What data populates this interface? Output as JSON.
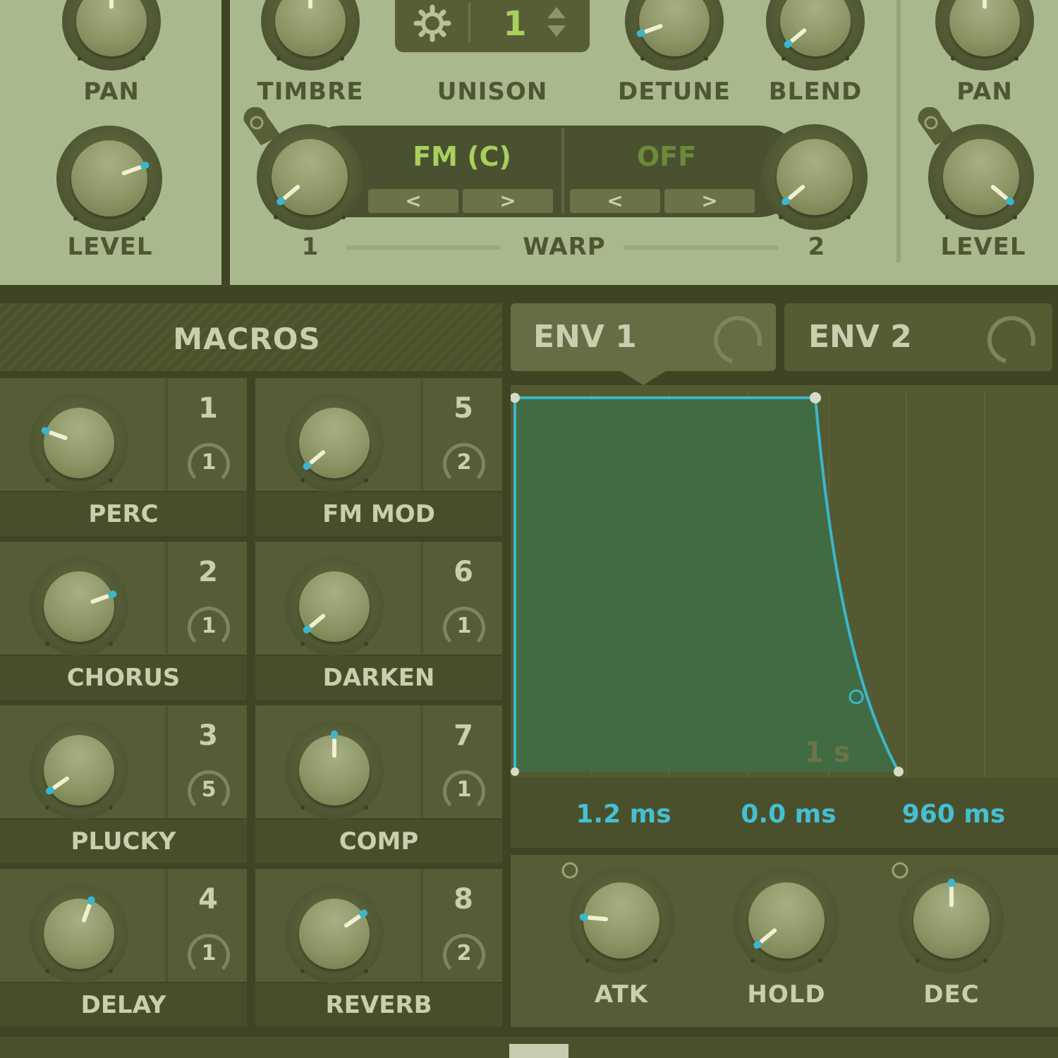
{
  "osc_left": {
    "pan_label": "PAN",
    "level_label": "LEVEL"
  },
  "osc_main": {
    "timbre_label": "TIMBRE",
    "unison_label": "UNISON",
    "unison_value": "1",
    "detune_label": "DETUNE",
    "blend_label": "BLEND",
    "warp1_mode": "FM (C)",
    "warp2_mode": "OFF",
    "prev_arrow": "<",
    "next_arrow": ">",
    "warp_label": "WARP",
    "warp1_num": "1",
    "warp2_num": "2"
  },
  "osc_right": {
    "pan_label": "PAN",
    "level_label": "LEVEL"
  },
  "macros": {
    "title": "MACROS",
    "items": [
      {
        "label": "PERC",
        "number": "1",
        "mod": "1"
      },
      {
        "label": "FM MOD",
        "number": "5",
        "mod": "2"
      },
      {
        "label": "CHORUS",
        "number": "2",
        "mod": "1"
      },
      {
        "label": "DARKEN",
        "number": "6",
        "mod": "1"
      },
      {
        "label": "PLUCKY",
        "number": "3",
        "mod": "5"
      },
      {
        "label": "COMP",
        "number": "7",
        "mod": "1"
      },
      {
        "label": "DELAY",
        "number": "4",
        "mod": "1"
      },
      {
        "label": "REVERB",
        "number": "8",
        "mod": "2"
      }
    ]
  },
  "envelope": {
    "tab1": "ENV 1",
    "tab2": "ENV 2",
    "time_marker": "1 s",
    "attack_value": "1.2 ms",
    "hold_value": "0.0 ms",
    "decay_value": "960 ms",
    "atk_label": "ATK",
    "hold_label": "HOLD",
    "dec_label": "DEC"
  },
  "colors": {
    "accent": "#3cb6cc",
    "panel_light": "#aab88e",
    "panel_dark": "#565c35",
    "label_dark": "#4e5632",
    "label_light": "#c9cfae"
  }
}
